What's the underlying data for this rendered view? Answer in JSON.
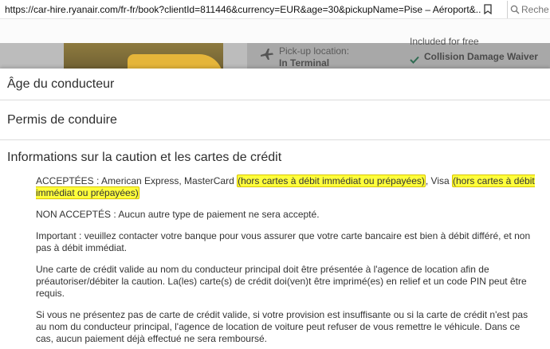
{
  "browser": {
    "url": "https://car-hire.ryanair.com/fr-fr/book?clientId=811446&currency=EUR&age=30&pickupName=Pise – Aéroport&...",
    "search_placeholder": "Reche"
  },
  "background_page": {
    "pickup_label": "Pick-up location:",
    "pickup_value": "In Terminal",
    "included_label": "Included for free",
    "cdw_label": "Collision Damage Waiver"
  },
  "accordion": {
    "item1": "Âge du conducteur",
    "item2": "Permis de conduire",
    "item3": "Informations sur la caution et les cartes de crédit"
  },
  "deposit_info": {
    "accepted_prefix": "ACCEPTÉES : American Express, MasterCard ",
    "accepted_hl1": "(hors cartes à débit immédiat ou prépayées)",
    "accepted_mid": ", Visa ",
    "accepted_hl2": "(hors cartes à débit immédiat ou prépayées)",
    "not_accepted": "NON ACCEPTÉS : Aucun autre type de paiement ne sera accepté.",
    "important": "Important : veuillez contacter votre banque pour vous assurer que votre carte bancaire est bien à débit différé, et non pas à débit immédiat.",
    "card_required": "Une carte de crédit valide au nom du conducteur principal doit être présentée à l'agence de location afin de préautoriser/débiter la caution. La(les) carte(s) de crédit doi(ven)t être imprimé(es) en relief et un code PIN peut être requis.",
    "refusal": "Si vous ne présentez pas de carte de crédit valide, si votre provision est insuffisante ou si la carte de crédit n'est pas au nom du conducteur principal, l'agence de location de voiture peut refuser de vous remettre le véhicule. Dans ce cas, aucun paiement déjà effectué ne sera remboursé."
  }
}
